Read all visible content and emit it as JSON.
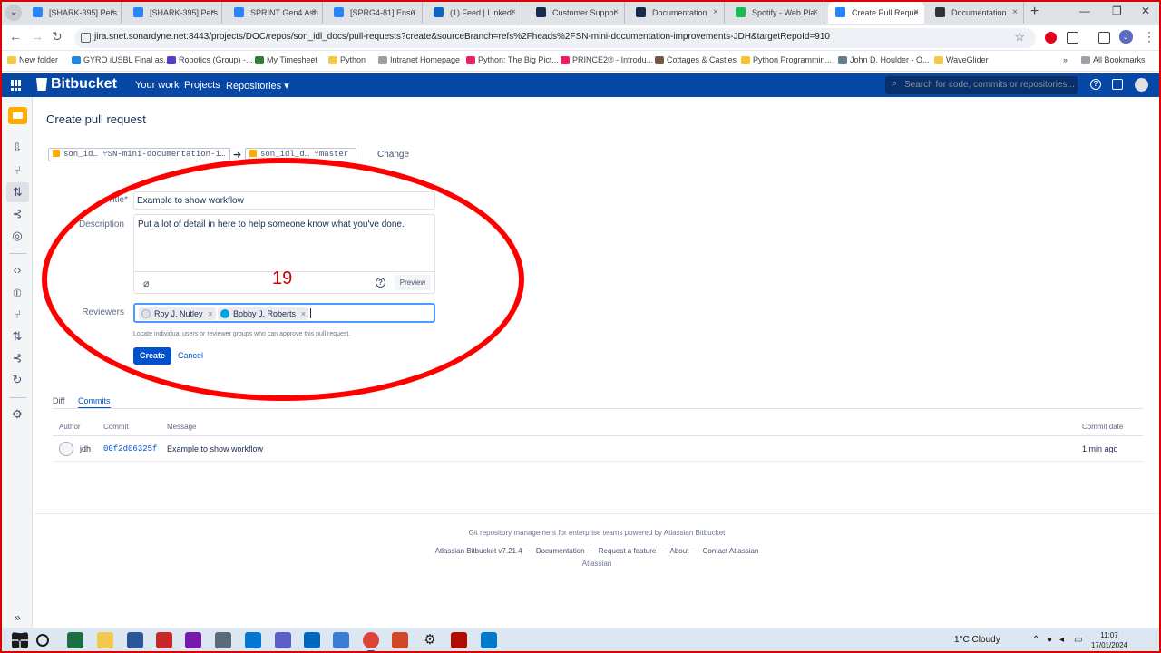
{
  "browser": {
    "tabs": [
      {
        "label": "[SHARK-395] Pers",
        "color": "#2684ff"
      },
      {
        "label": "[SHARK-395] Pers",
        "color": "#2684ff"
      },
      {
        "label": "SPRINT Gen4 Ash",
        "color": "#2684ff"
      },
      {
        "label": "[SPRG4-81] Ensu",
        "color": "#2684ff"
      },
      {
        "label": "(1) Feed | Linkedl",
        "color": "#0a66c2"
      },
      {
        "label": "Customer Suppor",
        "color": "#172b4d"
      },
      {
        "label": "Documentation",
        "color": "#172b4d"
      },
      {
        "label": "Spotify - Web Pla",
        "color": "#1db954"
      },
      {
        "label": "Create Pull Reque",
        "color": "#2684ff"
      },
      {
        "label": "Documentation",
        "color": "#333333"
      }
    ],
    "url": "jira.snet.sonardyne.net:8443/projects/DOC/repos/son_idl_docs/pull-requests?create&sourceBranch=refs%2Fheads%2FSN-mini-documentation-improvements-JDH&targetRepoId=910",
    "profile_initial": "J",
    "bookmarks": [
      {
        "label": "New folder",
        "color": "#f2c94c"
      },
      {
        "label": "GYRO iUSBL Final as...",
        "color": "#1e88e5"
      },
      {
        "label": "Robotics (Group) -...",
        "color": "#5b3cc4"
      },
      {
        "label": "My Timesheet",
        "color": "#2e7d32"
      },
      {
        "label": "Python",
        "color": "#f2c94c"
      },
      {
        "label": "Intranet Homepage",
        "color": "#9e9e9e"
      },
      {
        "label": "Python: The Big Pict...",
        "color": "#e91e63"
      },
      {
        "label": "PRINCE2® - Introdu...",
        "color": "#e91e63"
      },
      {
        "label": "Cottages & Castles",
        "color": "#795548"
      },
      {
        "label": "Python Programmin...",
        "color": "#fbc02d"
      },
      {
        "label": "John D. Houlder - O...",
        "color": "#607d8b"
      },
      {
        "label": "WaveGlider",
        "color": "#f2c94c"
      }
    ],
    "more_bookmarks": "»",
    "all_bookmarks": "All Bookmarks"
  },
  "bitbucket": {
    "brand": "Bitbucket",
    "nav": [
      "Your work",
      "Projects",
      "Repositories ▾"
    ],
    "search_placeholder": "Search for code, commits or repositories...",
    "help_glyph": "?"
  },
  "page": {
    "title": "Create pull request",
    "source_repo": "son_id…",
    "source_branch": "SN-mini-documentation-i…",
    "arrow": "➜",
    "target_repo": "son_idl_d…",
    "target_branch": "master",
    "change_label": "Change"
  },
  "form": {
    "title_label": "Title*",
    "title_value": "Example to show workflow",
    "description_label": "Description",
    "description_value": "Put a lot of detail in here to help someone know what you've done.",
    "preview_label": "Preview",
    "reviewers_label": "Reviewers",
    "reviewers": [
      {
        "name": "Roy J. Nutley",
        "avatar_color": "#dfe1e6"
      },
      {
        "name": "Bobby J. Roberts",
        "avatar_color": "#00a3e0",
        "initials": "BJR"
      }
    ],
    "remove_glyph": "×",
    "helper_text": "Locate individual users or reviewer groups who can approve this pull request.",
    "create_label": "Create",
    "cancel_label": "Cancel"
  },
  "annotation": {
    "number": "19",
    "color": "#ff0000"
  },
  "commits_section": {
    "tabs": [
      "Diff",
      "Commits"
    ],
    "active_tab": "Commits",
    "headers": {
      "author": "Author",
      "commit": "Commit",
      "message": "Message",
      "date": "Commit date"
    },
    "rows": [
      {
        "author": "jdh",
        "commit": "00f2d06325f",
        "message": "Example to show workflow",
        "date": "1 min ago"
      }
    ]
  },
  "footer": {
    "tagline": "Git repository management for enterprise teams powered by Atlassian Bitbucket",
    "links": [
      "Atlassian Bitbucket v7.21.4",
      "Documentation",
      "Request a feature",
      "About",
      "Contact Atlassian"
    ],
    "separator": "·",
    "company": "Atlassian"
  },
  "taskbar": {
    "weather": "1°C  Cloudy",
    "time": "11:07",
    "date": "17/01/2024"
  }
}
